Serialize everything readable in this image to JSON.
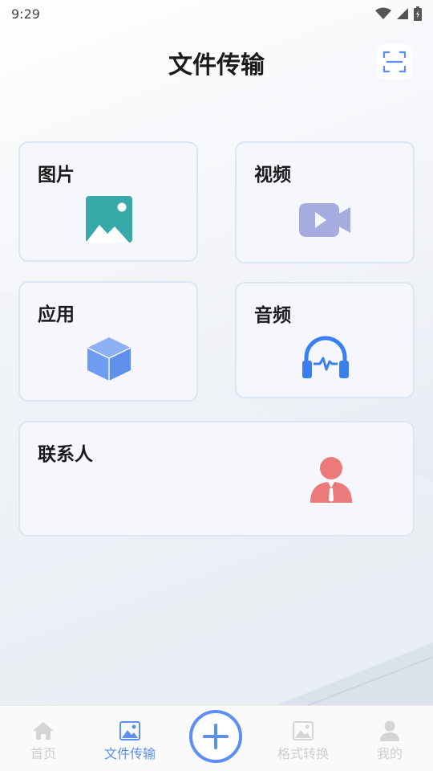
{
  "status_bar": {
    "time": "9:29"
  },
  "header": {
    "title": "文件传输",
    "scan_icon": "scan-icon"
  },
  "cards": {
    "images": {
      "label": "图片",
      "icon": "image-icon"
    },
    "video": {
      "label": "视频",
      "icon": "video-camera-icon"
    },
    "apps": {
      "label": "应用",
      "icon": "cube-icon"
    },
    "audio": {
      "label": "音频",
      "icon": "headphones-icon"
    },
    "contacts": {
      "label": "联系人",
      "icon": "person-icon"
    }
  },
  "tabbar": {
    "home": {
      "label": "首页",
      "icon": "home-icon"
    },
    "transfer": {
      "label": "文件传输",
      "icon": "image-icon"
    },
    "add": {
      "icon": "plus-icon"
    },
    "convert": {
      "label": "格式转换",
      "icon": "image-icon"
    },
    "profile": {
      "label": "我的",
      "icon": "user-icon"
    }
  },
  "colors": {
    "accent": "#5b8ff2",
    "image_icon": "#36a9a8",
    "video_icon": "#a6abe0",
    "cube_icon": "#6e9cf0",
    "audio_icon": "#3a7ff0",
    "contact_icon": "#ec7a78"
  }
}
